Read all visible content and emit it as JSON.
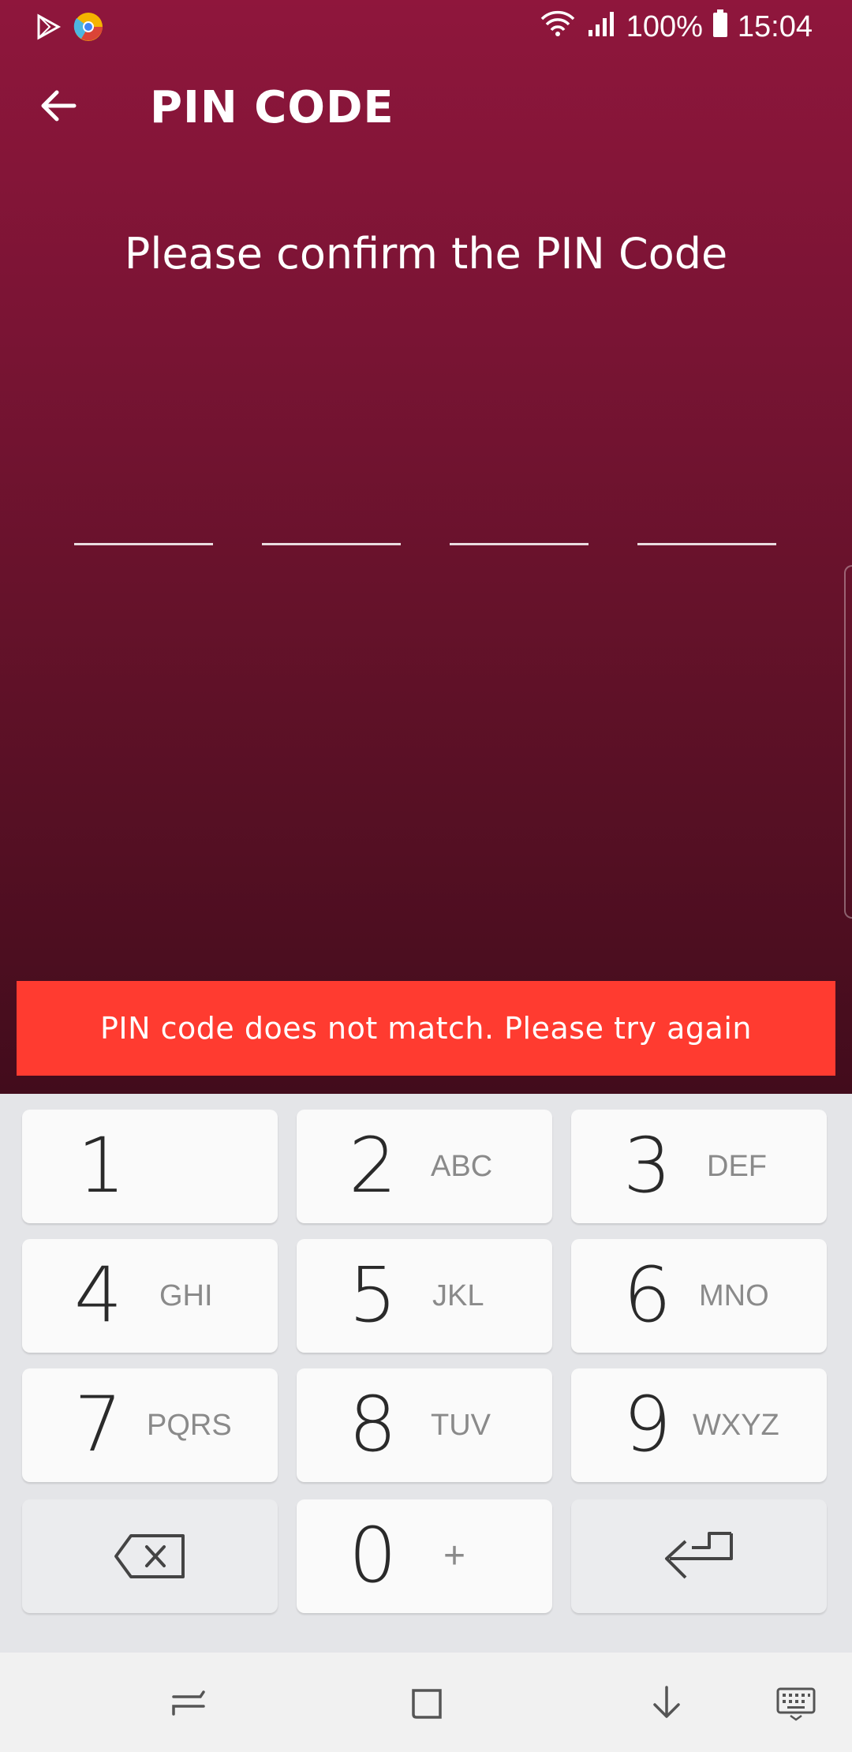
{
  "status_bar": {
    "battery": "100%",
    "time": "15:04",
    "icons": [
      "play-store-icon",
      "chrome-icon",
      "wifi-icon",
      "signal-icon",
      "battery-icon"
    ]
  },
  "header": {
    "title": "PIN CODE",
    "back_icon": "arrow-back-icon"
  },
  "main": {
    "prompt": "Please confirm the PIN Code",
    "pin_slots": [
      "",
      "",
      "",
      ""
    ]
  },
  "error": {
    "message": "PIN code does not match. Please try again",
    "color": "#ff3b30"
  },
  "keypad": {
    "keys": [
      {
        "digit": "1",
        "letters": ""
      },
      {
        "digit": "2",
        "letters": "ABC"
      },
      {
        "digit": "3",
        "letters": "DEF"
      },
      {
        "digit": "4",
        "letters": "GHI"
      },
      {
        "digit": "5",
        "letters": "JKL"
      },
      {
        "digit": "6",
        "letters": "MNO"
      },
      {
        "digit": "7",
        "letters": "PQRS"
      },
      {
        "digit": "8",
        "letters": "TUV"
      },
      {
        "digit": "9",
        "letters": "WXYZ"
      },
      {
        "digit": "0",
        "letters": "+"
      }
    ],
    "backspace_icon": "backspace-icon",
    "enter_icon": "enter-icon"
  },
  "nav_bar": {
    "icons": [
      "recent-apps-icon",
      "home-icon",
      "hide-keyboard-icon",
      "keyboard-switch-icon"
    ]
  },
  "theme": {
    "primary": "#8f163c",
    "primary_dark": "#420c1c"
  }
}
